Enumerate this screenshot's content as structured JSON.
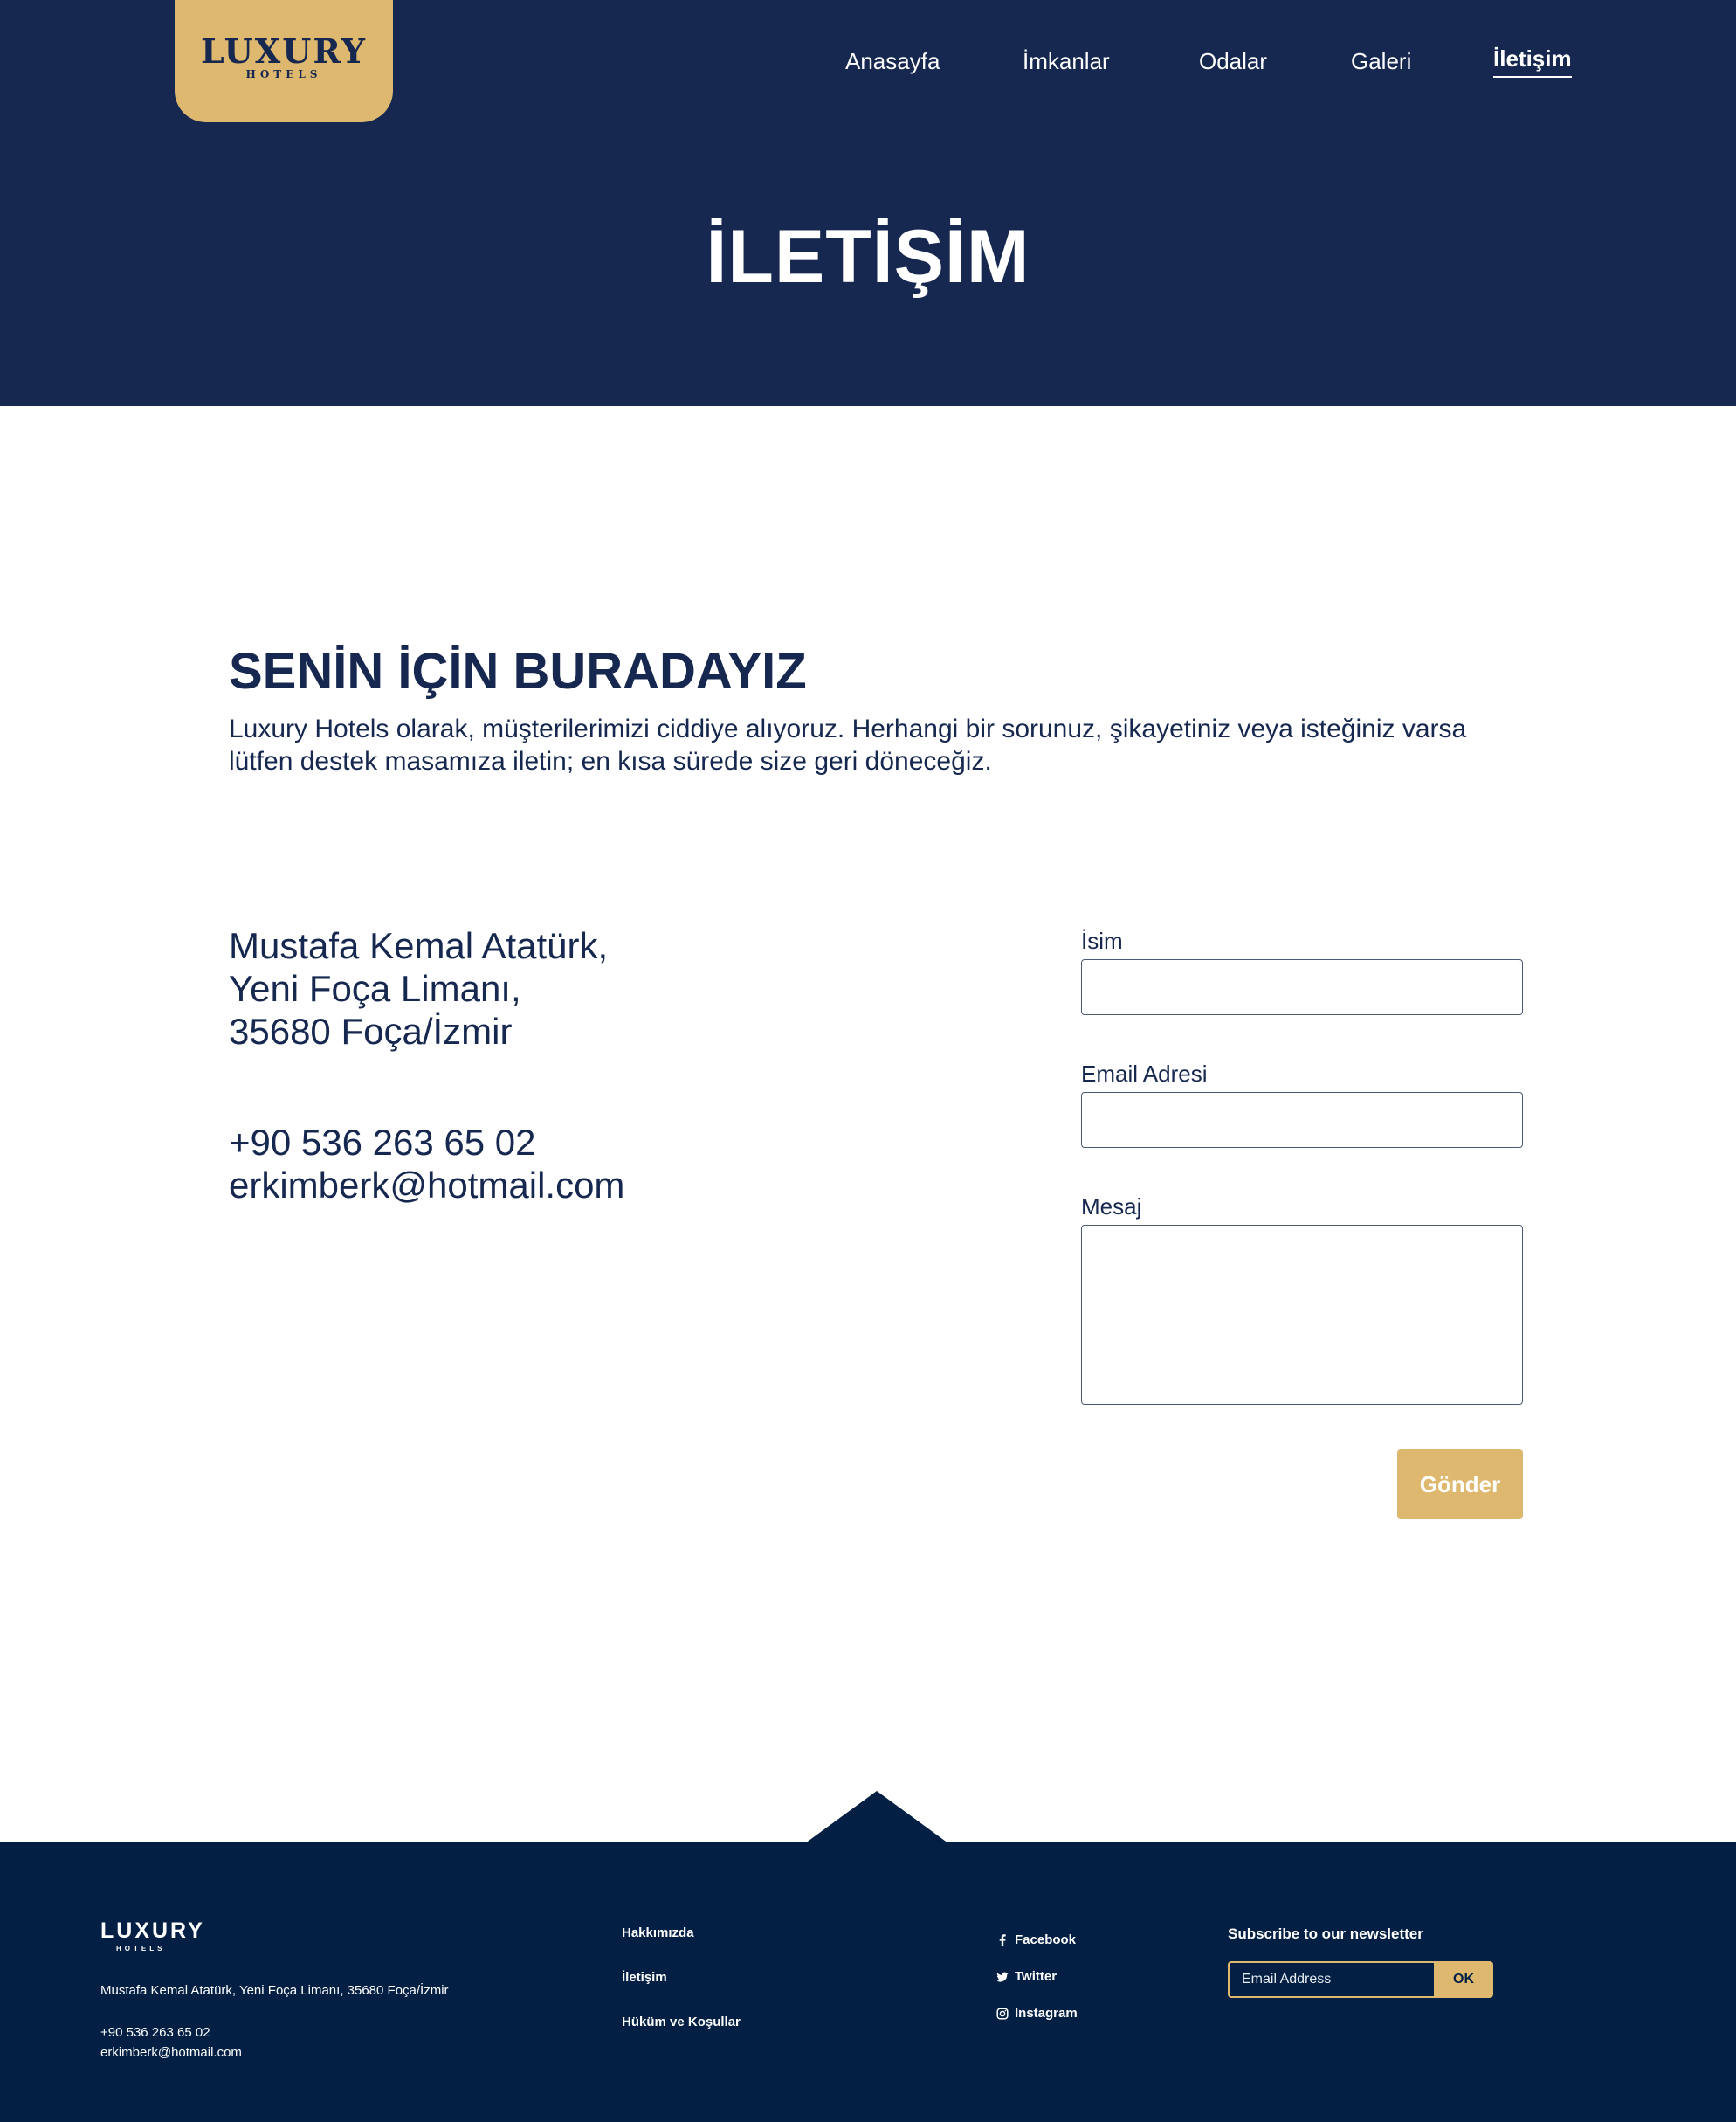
{
  "brand": {
    "name": "LUXURY",
    "sub": "HOTELS",
    "accent": "#dfb86f",
    "navy": "#16284f",
    "footer_bg": "#032044"
  },
  "nav": {
    "items": [
      {
        "label": "Anasayfa"
      },
      {
        "label": "İmkanlar"
      },
      {
        "label": "Odalar"
      },
      {
        "label": "Galeri"
      },
      {
        "label": "İletişim",
        "active": true
      }
    ]
  },
  "hero": {
    "title": "İLETİŞİM"
  },
  "main": {
    "heading": "SENİN İÇİN BURADAYIZ",
    "intro": "Luxury Hotels olarak, müşterilerimizi ciddiye alıyoruz. Herhangi bir sorunuz, şikayetiniz veya isteğiniz varsa lütfen destek masamıza iletin; en kısa sürede size geri döneceğiz.",
    "address": [
      "Mustafa Kemal Atatürk,",
      "Yeni Foça Limanı,",
      "35680 Foça/İzmir"
    ],
    "phone": "+90 536 263 65 02",
    "email": "erkimberk@hotmail.com"
  },
  "form": {
    "name_label": "İsim",
    "name_value": "",
    "email_label": "Email Adresi",
    "email_value": "",
    "message_label": "Mesaj",
    "message_value": "",
    "submit_label": "Gönder"
  },
  "footer": {
    "logo": "LUXURY",
    "logo_sub": "HOTELS",
    "address": "Mustafa Kemal Atatürk, Yeni Foça Limanı, 35680 Foça/İzmir",
    "phone": "+90 536 263 65 02",
    "email": "erkimberk@hotmail.com",
    "links": [
      "Hakkımızda",
      "İletişim",
      "Hüküm ve Koşullar"
    ],
    "social": [
      {
        "label": "Facebook",
        "icon": "facebook-icon"
      },
      {
        "label": "Twitter",
        "icon": "twitter-icon"
      },
      {
        "label": "Instagram",
        "icon": "instagram-icon"
      }
    ],
    "newsletter": {
      "title": "Subscribe to our newsletter",
      "placeholder": "Email Address",
      "button": "OK"
    }
  }
}
